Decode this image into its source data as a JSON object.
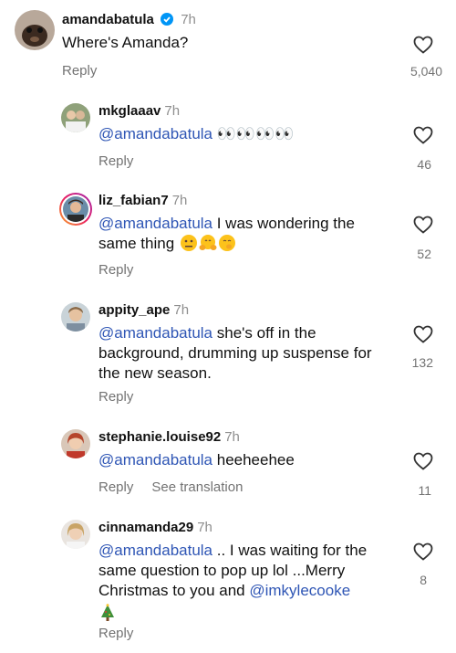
{
  "comments": [
    {
      "user": "amandabatula",
      "time": "7h",
      "verified": true,
      "mention": "",
      "text": "Where's Amanda?",
      "reply": "Reply",
      "likes": "5,040",
      "avatar": "avatar-dog"
    },
    {
      "user": "mkglaaav",
      "time": "7h",
      "mention": "@amandabatula",
      "text": "👀👀👀👀",
      "reply": "Reply",
      "likes": "46",
      "avatar": "avatar-couple"
    },
    {
      "user": "liz_fabian7",
      "time": "7h",
      "mention": "@amandabatula",
      "text": " I was wondering the same thing ",
      "emojis": [
        "neutral-face-emoji",
        "hug-emoji",
        "kiss-emoji"
      ],
      "reply": "Reply",
      "likes": "52",
      "avatar": "avatar-story-ring"
    },
    {
      "user": "appity_ape",
      "time": "7h",
      "mention": "@amandabatula",
      "text": " she's off in the background, drumming up suspense for the new season.",
      "reply": "Reply",
      "likes": "132",
      "avatar": "avatar-woman"
    },
    {
      "user": "stephanie.louise92",
      "time": "7h",
      "mention": "@amandabatula",
      "text": " heeheehee",
      "reply": "Reply",
      "see_translation": "See translation",
      "likes": "11",
      "avatar": "avatar-redhead"
    },
    {
      "user": "cinnamanda29",
      "time": "7h",
      "mention": "@amandabatula",
      "text": " .. I was waiting for the same question to pop up lol ...Merry Christmas to you and ",
      "mention2": "@imkylecooke",
      "emoji_end": "🎄",
      "reply": "Reply",
      "likes": "8",
      "avatar": "avatar-blonde"
    }
  ],
  "colors": {
    "mention": "#2f56b5",
    "muted": "#737373",
    "verified": "#0095f6"
  }
}
